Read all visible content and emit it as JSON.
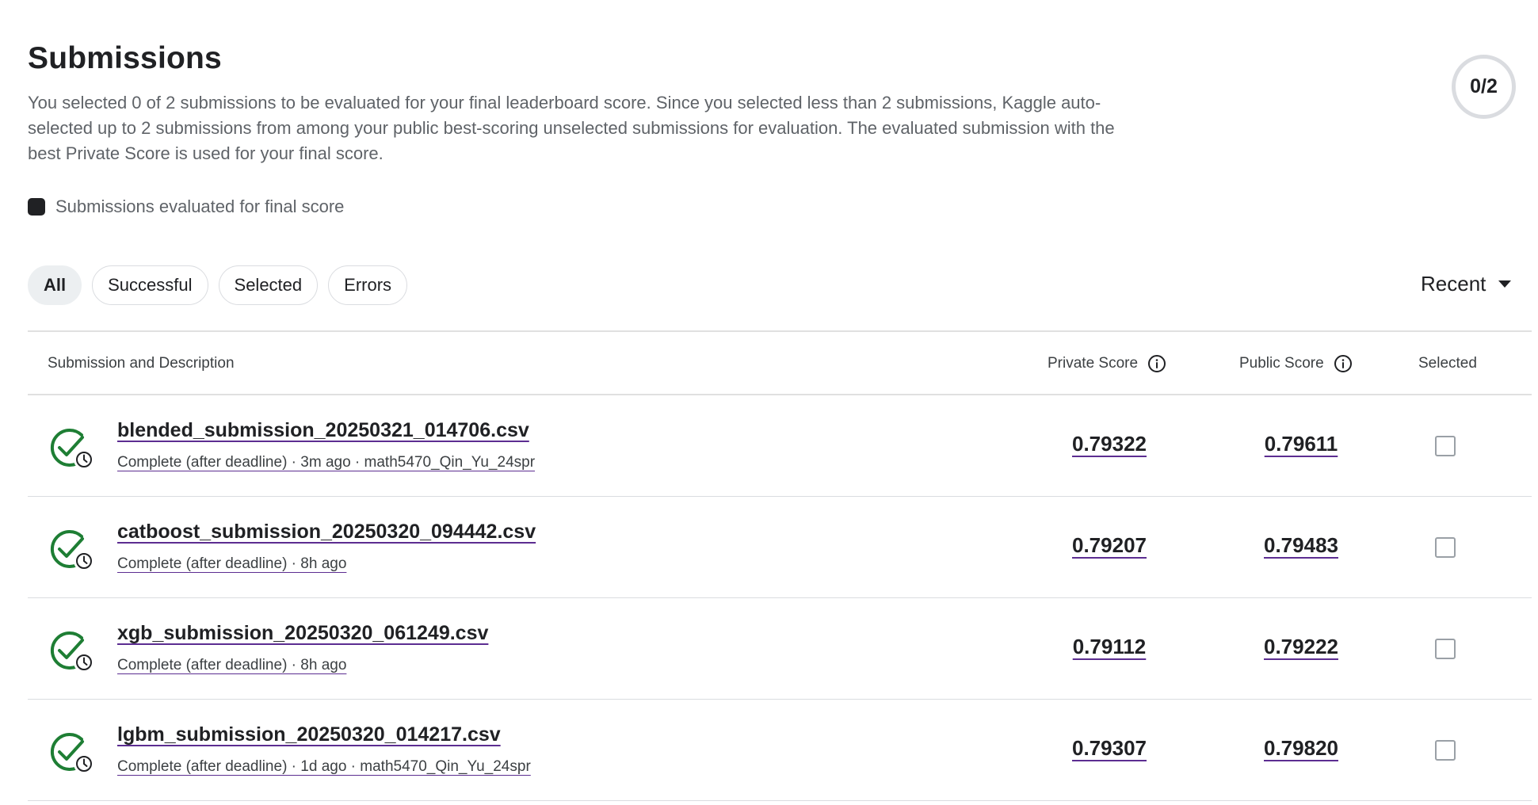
{
  "page": {
    "title": "Submissions",
    "description": "You selected 0 of 2 submissions to be evaluated for your final leaderboard score. Since you selected less than 2 submissions, Kaggle auto-selected up to 2 submissions from among your public best-scoring unselected submissions for evaluation. The evaluated submission with the best Private Score is used for your final score.",
    "counter": "0/2",
    "legend_label": "Submissions evaluated for final score"
  },
  "filters": [
    {
      "label": "All",
      "active": true
    },
    {
      "label": "Successful",
      "active": false
    },
    {
      "label": "Selected",
      "active": false
    },
    {
      "label": "Errors",
      "active": false
    }
  ],
  "sort": {
    "label": "Recent"
  },
  "table": {
    "headers": {
      "submission": "Submission and Description",
      "private_score": "Private Score",
      "public_score": "Public Score",
      "selected": "Selected"
    },
    "rows": [
      {
        "filename": "blended_submission_20250321_014706.csv",
        "meta": "Complete (after deadline) · 3m ago · math5470_Qin_Yu_24spr",
        "private": "0.79322",
        "public": "0.79611",
        "selected": false
      },
      {
        "filename": "catboost_submission_20250320_094442.csv",
        "meta": "Complete (after deadline) · 8h ago",
        "private": "0.79207",
        "public": "0.79483",
        "selected": false
      },
      {
        "filename": "xgb_submission_20250320_061249.csv",
        "meta": "Complete (after deadline) · 8h ago",
        "private": "0.79112",
        "public": "0.79222",
        "selected": false
      },
      {
        "filename": "lgbm_submission_20250320_014217.csv",
        "meta": "Complete (after deadline) · 1d ago · math5470_Qin_Yu_24spr",
        "private": "0.79307",
        "public": "0.79820",
        "selected": false
      }
    ]
  },
  "icons": {
    "status": "check-circle-with-clock-icon",
    "info": "info-icon",
    "sort": "caret-down-icon"
  },
  "colors": {
    "success_green": "#1e7e34",
    "link_underline": "#5c2d91",
    "active_chip_bg": "#eceff1"
  }
}
